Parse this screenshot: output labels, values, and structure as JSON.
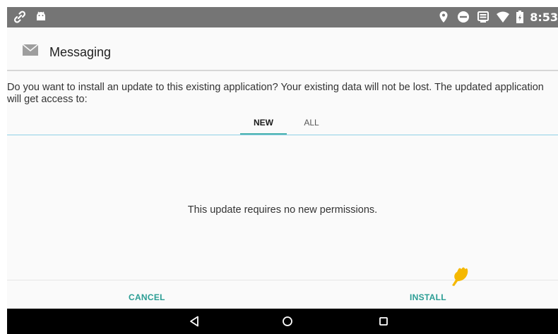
{
  "status_bar": {
    "time": "8:53",
    "left_icons": [
      "link-icon",
      "android-icon"
    ],
    "right_icons": [
      "location-icon",
      "do-not-disturb-icon",
      "cast-icon",
      "wifi-icon",
      "battery-icon"
    ]
  },
  "header": {
    "icon": "mail-icon",
    "title": "Messaging"
  },
  "body": {
    "question": "Do you want to install an update to this existing application? Your existing data will not be lost. The updated application will get access to:",
    "tabs": [
      {
        "label": "NEW",
        "selected": true
      },
      {
        "label": "ALL",
        "selected": false
      }
    ],
    "message": "This update requires no new permissions."
  },
  "buttons": {
    "cancel": "CANCEL",
    "install": "INSTALL"
  },
  "nav_bar": {
    "icons": [
      "back-icon",
      "home-icon",
      "recents-icon"
    ]
  },
  "colors": {
    "status_bar": "#757575",
    "accent": "#2a9d94",
    "tab_indicator": "#4bb3b0",
    "pointer": "#f5b800"
  }
}
